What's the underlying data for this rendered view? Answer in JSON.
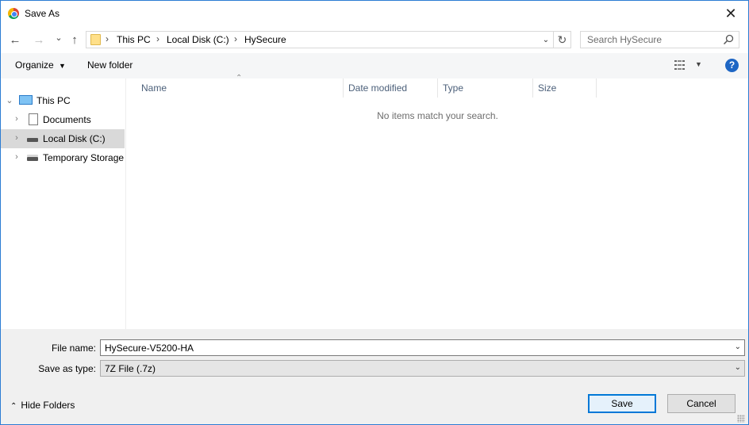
{
  "window": {
    "title": "Save As",
    "close_glyph": "✕",
    "app_icon": "chrome-icon"
  },
  "nav": {
    "back_glyph": "←",
    "forward_glyph": "→",
    "recent_glyph": "⌄",
    "up_glyph": "↑",
    "breadcrumb": [
      "This PC",
      "Local Disk (C:)",
      "HySecure"
    ],
    "refresh_glyph": "↻",
    "search_placeholder": "Search HySecure"
  },
  "toolbar": {
    "organize_label": "Organize",
    "new_folder_label": "New folder",
    "help_glyph": "?"
  },
  "tree": {
    "items": [
      {
        "label": "This PC",
        "icon": "computer-icon",
        "expanded": true
      },
      {
        "label": "Documents",
        "icon": "document-icon",
        "expanded": false
      },
      {
        "label": "Local Disk (C:)",
        "icon": "drive-icon",
        "expanded": false,
        "selected": true
      },
      {
        "label": "Temporary Storage",
        "icon": "drive-icon",
        "expanded": false
      }
    ]
  },
  "filelist": {
    "columns": [
      "Name",
      "Date modified",
      "Type",
      "Size"
    ],
    "empty_message": "No items match your search."
  },
  "form": {
    "filename_label": "File name:",
    "filename_value": "HySecure-V5200-HA",
    "filetype_label": "Save as type:",
    "filetype_value": "7Z File (.7z)"
  },
  "footer": {
    "hide_folders_label": "Hide Folders",
    "save_label": "Save",
    "cancel_label": "Cancel"
  },
  "colors": {
    "accent": "#0078d7",
    "selection": "#d9d9d9",
    "help": "#1e66c4"
  }
}
